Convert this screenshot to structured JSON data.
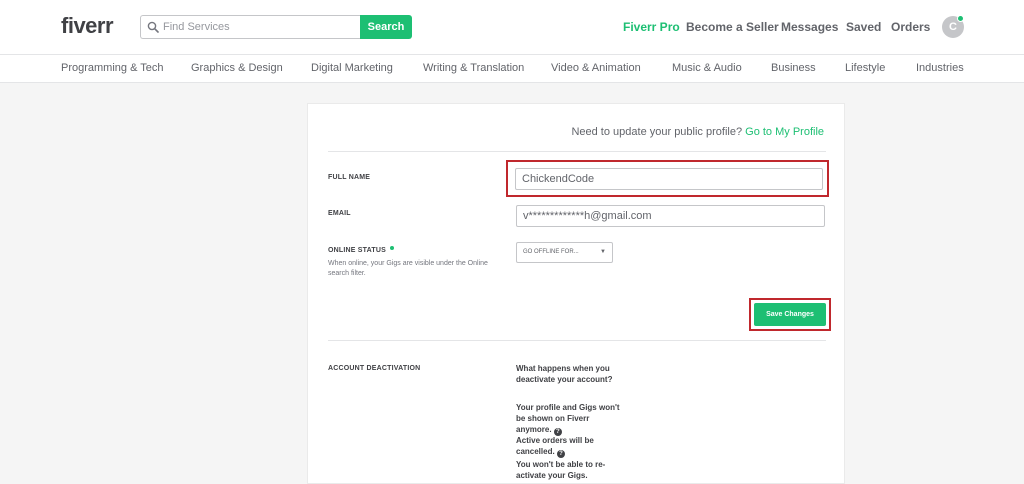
{
  "header": {
    "logo": "fiverr",
    "search_placeholder": "Find Services",
    "search_button": "Search",
    "nav": {
      "pro": "Fiverr Pro",
      "seller": "Become a Seller",
      "messages": "Messages",
      "saved": "Saved",
      "orders": "Orders"
    },
    "avatar_initial": "C"
  },
  "categories": [
    "Programming & Tech",
    "Graphics & Design",
    "Digital Marketing",
    "Writing & Translation",
    "Video & Animation",
    "Music & Audio",
    "Business",
    "Lifestyle",
    "Industries"
  ],
  "settings": {
    "profile_prompt": "Need to update your public profile?",
    "profile_link": "Go to My Profile",
    "full_name_label": "FULL NAME",
    "full_name_value": "ChickendCode",
    "email_label": "EMAIL",
    "email_value": "v*************h@gmail.com",
    "online_status_label": "ONLINE STATUS",
    "online_status_help": "When online, your Gigs are visible under the Online search filter.",
    "online_status_select": "GO OFFLINE FOR...",
    "save_button": "Save Changes",
    "deactivation_label": "ACCOUNT DEACTIVATION",
    "deactivation_question": "What happens when you deactivate your account?",
    "deactivation_items": [
      "Your profile and Gigs won't be shown on Fiverr anymore.",
      "Active orders will be cancelled.",
      "You won't be able to re-activate your Gigs."
    ]
  },
  "colors": {
    "brand_green": "#1dbf73",
    "highlight_red": "#c0282d"
  }
}
